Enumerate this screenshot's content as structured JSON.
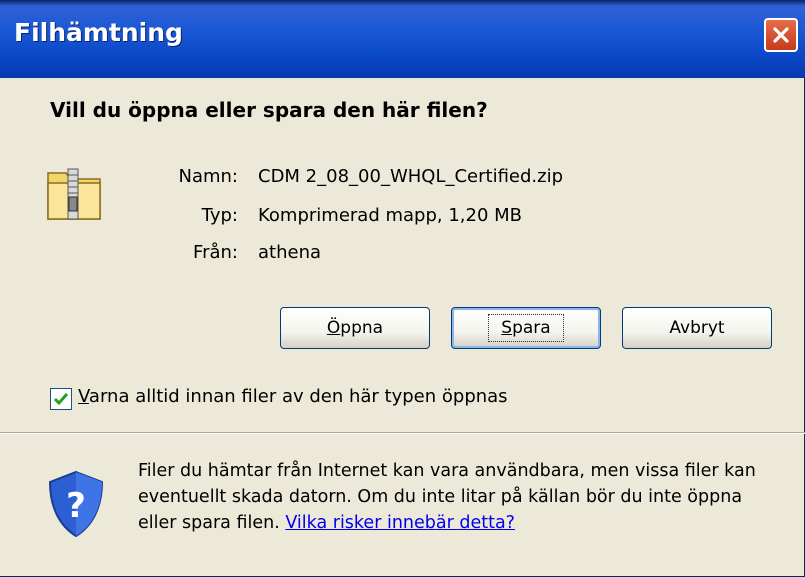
{
  "window": {
    "title": "Filhämtning"
  },
  "dialog": {
    "question": "Vill du öppna eller spara den här filen?",
    "file": {
      "name_label": "Namn:",
      "name_value": "CDM 2_08_00_WHQL_Certified.zip",
      "type_label": "Typ:",
      "type_value": "Komprimerad mapp, 1,20 MB",
      "from_label": "Från:",
      "from_value": "athena"
    },
    "buttons": {
      "open_mnemonic": "Ö",
      "open_rest": "ppna",
      "save_mnemonic": "S",
      "save_rest": "para",
      "cancel": "Avbryt"
    },
    "checkbox": {
      "checked": true,
      "mnemonic": "V",
      "label_rest": "arna alltid innan filer av den här typen öppnas"
    },
    "warning": {
      "text": "Filer du hämtar från Internet kan vara användbara, men vissa filer kan eventuellt skada datorn. Om du inte litar på källan bör du inte öppna eller spara filen. ",
      "link": "Vilka risker innebär detta?"
    }
  },
  "icons": {
    "file_icon": "zip-folder-icon",
    "security_icon": "shield-question-icon",
    "close_icon": "close-icon"
  },
  "colors": {
    "titlebar": "#0a49c8",
    "dialog_bg": "#ece9d8",
    "close_button": "#d9502e",
    "link": "#0000ee"
  }
}
